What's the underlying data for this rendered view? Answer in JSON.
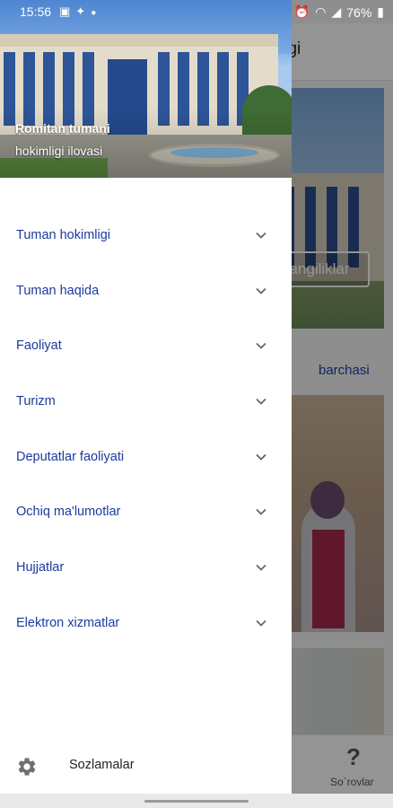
{
  "status_bar": {
    "time": "15:56",
    "battery": "76%"
  },
  "background_screen": {
    "appbar_title_fragment": "imligi",
    "news_button_fragment": "angiliklar",
    "all_link": "barchasi",
    "bottom_nav_label": "So`rovlar",
    "bottom_nav_label_partial": "r",
    "bottom_nav_icon": "?"
  },
  "drawer": {
    "header": {
      "title": "Romitan tumani",
      "subtitle": "hokimligi ilovasi"
    },
    "menu_items": [
      {
        "label": "Tuman hokimligi",
        "icon": "chevron-down-icon"
      },
      {
        "label": "Tuman haqida",
        "icon": "chevron-down-icon"
      },
      {
        "label": "Faoliyat",
        "icon": "chevron-down-icon"
      },
      {
        "label": "Turizm",
        "icon": "chevron-down-icon"
      },
      {
        "label": "Deputatlar faoliyati",
        "icon": "chevron-down-icon"
      },
      {
        "label": "Ochiq ma'lumotlar",
        "icon": "chevron-down-icon"
      },
      {
        "label": "Hujjatlar",
        "icon": "chevron-down-icon"
      },
      {
        "label": "Elektron xizmatlar",
        "icon": "chevron-down-icon"
      }
    ],
    "settings": {
      "label": "Sozlamalar",
      "icon": "gear-icon"
    }
  },
  "colors": {
    "menu_text": "#1b3a9e",
    "link": "#1b3fa7",
    "scrim": "rgba(0,0,0,0.42)"
  }
}
